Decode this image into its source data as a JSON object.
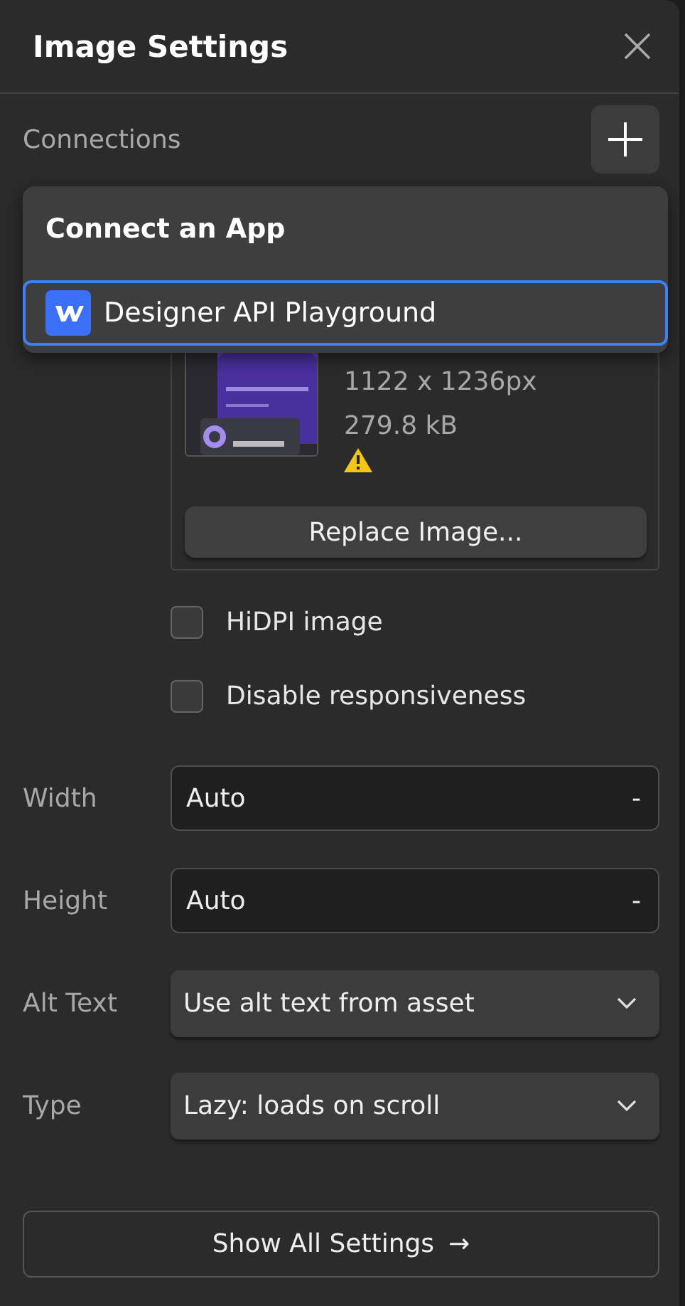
{
  "panel": {
    "title": "Image Settings"
  },
  "connections": {
    "label": "Connections"
  },
  "dropdown": {
    "heading": "Connect an App",
    "items": [
      {
        "label": "Designer API Playground",
        "selected": true
      }
    ]
  },
  "image": {
    "dimensions": "1122 x 1236px",
    "size": "279.8 kB",
    "warning": true,
    "replace_button": "Replace Image..."
  },
  "checkboxes": [
    {
      "label": "HiDPI image",
      "checked": false
    },
    {
      "label": "Disable responsiveness",
      "checked": false
    }
  ],
  "fields": [
    {
      "kind": "input",
      "label": "Width",
      "value": "Auto",
      "unit": "-"
    },
    {
      "kind": "input",
      "label": "Height",
      "value": "Auto",
      "unit": "-"
    },
    {
      "kind": "select",
      "label": "Alt Text",
      "value": "Use alt text from asset"
    },
    {
      "kind": "select",
      "label": "Type",
      "value": "Lazy: loads on scroll"
    }
  ],
  "footer_button": "Show All Settings",
  "footer_arrow": "→"
}
